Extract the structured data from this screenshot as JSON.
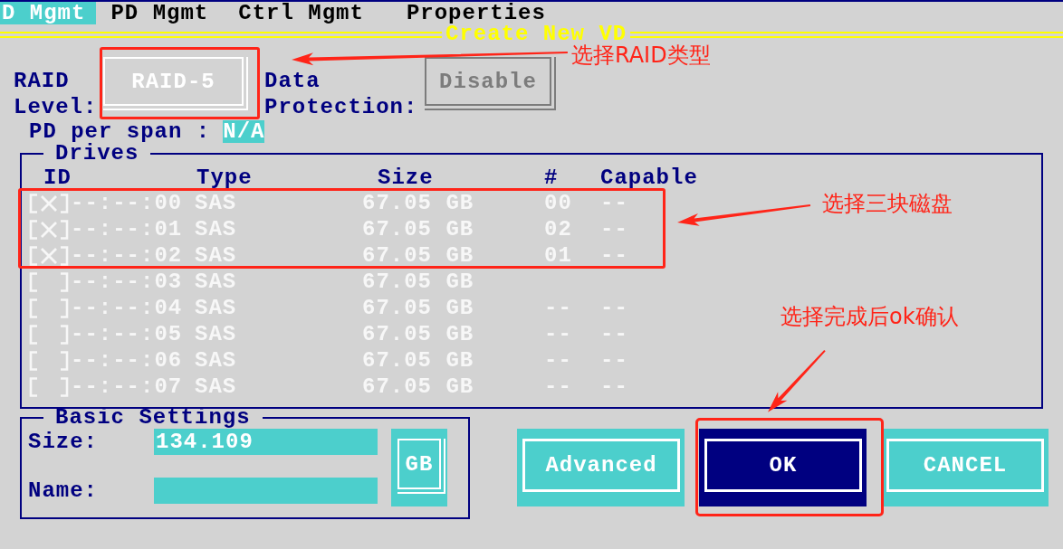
{
  "menu": [
    {
      "label": "D Mgmt",
      "selected": true
    },
    {
      "label": "PD Mgmt",
      "selected": false
    },
    {
      "label": "Ctrl Mgmt",
      "selected": false
    },
    {
      "label": "Properties",
      "selected": false
    }
  ],
  "dialog": {
    "title": "Create New VD",
    "raid_level": {
      "label": "RAID Level:",
      "value": "RAID-5"
    },
    "data_protection": {
      "label": "Data Protection:",
      "value": "Disable",
      "disabled": true
    },
    "pd_per_span": {
      "label": "PD per span :",
      "value": "N/A"
    },
    "drives": {
      "title": "Drives",
      "columns": [
        "ID",
        "Type",
        "Size",
        "#",
        "Capable"
      ],
      "rows": [
        {
          "checked": true,
          "id": "--:--:00",
          "type": "SAS",
          "size": "67.05 GB",
          "number": "00",
          "capable": "--"
        },
        {
          "checked": true,
          "id": "--:--:01",
          "type": "SAS",
          "size": "67.05 GB",
          "number": "02",
          "capable": "--"
        },
        {
          "checked": true,
          "id": "--:--:02",
          "type": "SAS",
          "size": "67.05 GB",
          "number": "01",
          "capable": "--"
        },
        {
          "checked": false,
          "id": "--:--:03",
          "type": "SAS",
          "size": "67.05 GB"
        },
        {
          "checked": false,
          "id": "--:--:04",
          "type": "SAS",
          "size": "67.05 GB",
          "number": "--",
          "capable": "--"
        },
        {
          "checked": false,
          "id": "--:--:05",
          "type": "SAS",
          "size": "67.05 GB",
          "number": "--",
          "capable": "--"
        },
        {
          "checked": false,
          "id": "--:--:06",
          "type": "SAS",
          "size": "67.05 GB",
          "number": "--",
          "capable": "--"
        },
        {
          "checked": false,
          "id": "--:--:07",
          "type": "SAS",
          "size": "67.05 GB",
          "number": "--",
          "capable": "--"
        }
      ]
    },
    "basic_settings": {
      "title": "Basic Settings",
      "size": {
        "label": "Size:",
        "value": "134.109"
      },
      "name": {
        "label": "Name:"
      },
      "unit": "GB"
    },
    "buttons": [
      {
        "label": "Advanced",
        "selected": false
      },
      {
        "label": "OK",
        "selected": true
      },
      {
        "label": "CANCEL",
        "selected": false
      }
    ]
  },
  "annotations": [
    {
      "text": "选择RAID类型"
    },
    {
      "text": "选择三块磁盘"
    },
    {
      "text": "选择完成后ok确认"
    }
  ]
}
